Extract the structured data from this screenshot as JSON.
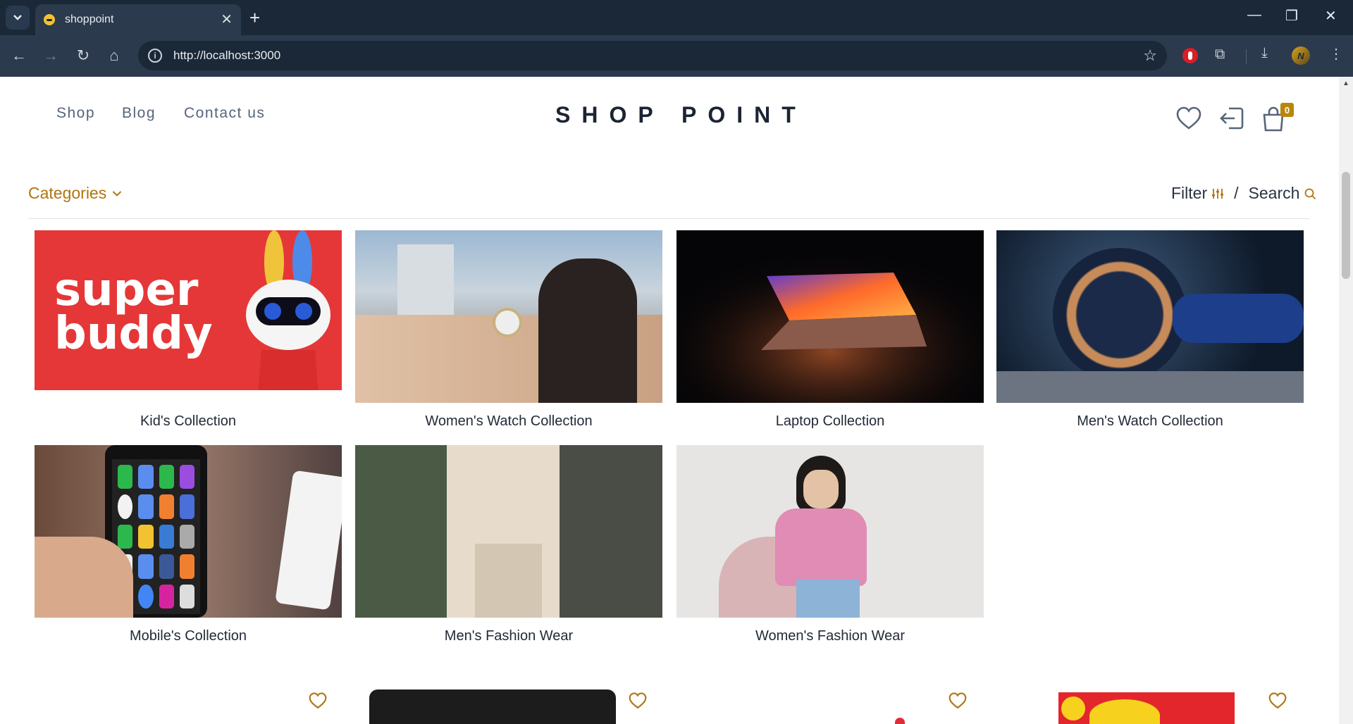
{
  "browser": {
    "tab_title": "shoppoint",
    "url": "http://localhost:3000"
  },
  "header": {
    "nav": [
      "Shop",
      "Blog",
      "Contact us"
    ],
    "logo": "SHOP POINT",
    "cart_count": "0"
  },
  "toolbar": {
    "categories_label": "Categories",
    "filter_label": "Filter",
    "divider": "/",
    "search_label": "Search"
  },
  "collections": [
    {
      "title": "Kid's Collection",
      "image_text": "super buddy"
    },
    {
      "title": "Women's Watch Collection"
    },
    {
      "title": "Laptop Collection"
    },
    {
      "title": "Men's Watch Collection"
    },
    {
      "title": "Mobile's Collection"
    },
    {
      "title": "Men's Fashion Wear"
    },
    {
      "title": "Women's Fashion Wear"
    }
  ],
  "colors": {
    "accent": "#b0750f",
    "logo": "#1a2433",
    "chrome_bg": "#1b2838"
  }
}
